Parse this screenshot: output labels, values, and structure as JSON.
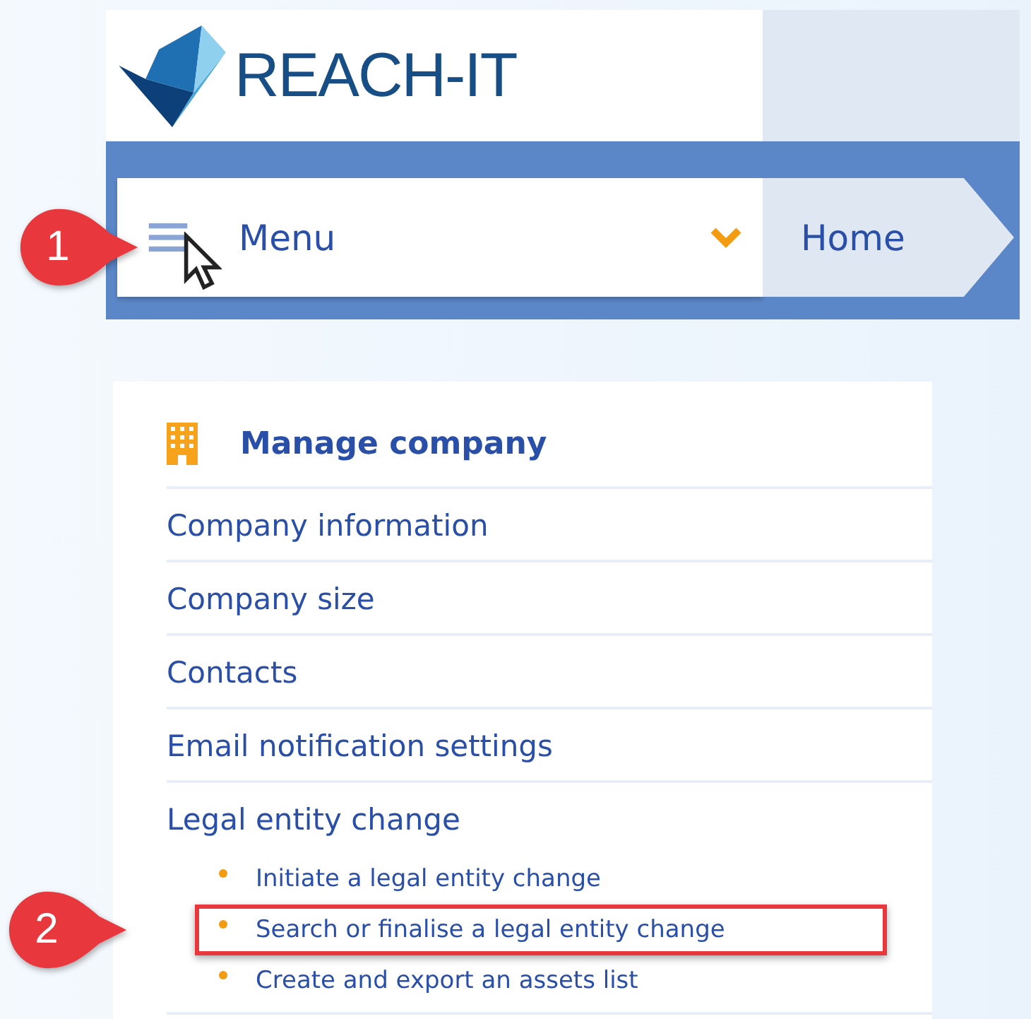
{
  "header": {
    "logo_text": "REACH-IT"
  },
  "menu_bar": {
    "label": "Menu",
    "expanded": false,
    "breadcrumb": "Home",
    "callout": "1"
  },
  "panel": {
    "title": "Manage company",
    "items": [
      {
        "label": "Company information"
      },
      {
        "label": "Company size"
      },
      {
        "label": "Contacts"
      },
      {
        "label": "Email notification settings"
      },
      {
        "label": "Legal entity change",
        "children": [
          {
            "label": "Initiate a legal entity change",
            "highlighted": false
          },
          {
            "label": "Search or finalise a legal entity change",
            "highlighted": true,
            "callout": "2"
          },
          {
            "label": "Create and export an assets list",
            "highlighted": false
          }
        ]
      }
    ]
  }
}
